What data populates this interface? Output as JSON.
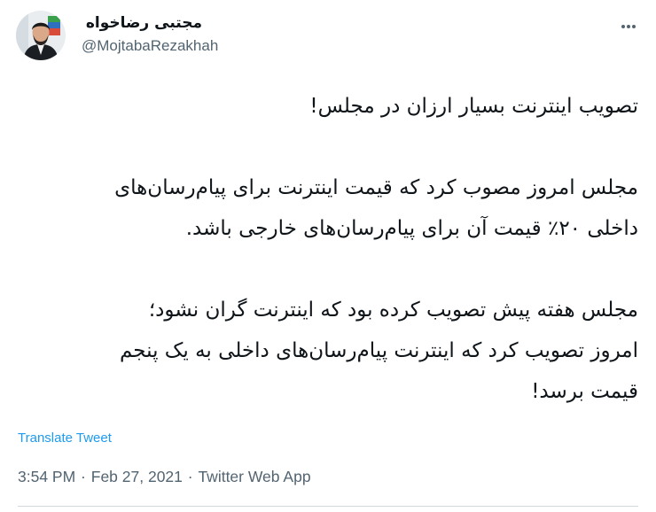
{
  "tweet": {
    "author": {
      "display_name": "مجتبی رضاخواه",
      "handle": "@MojtabaRezakhah"
    },
    "menu_icon": "more-horizontal-icon",
    "lines": [
      "تصویب اینترنت بسیار ارزان در مجلس!",
      "",
      "مجلس امروز مصوب کرد که قیمت اینترنت برای پیام‌رسان‌های",
      "داخلی ۲۰٪ قیمت آن برای پیام‌رسان‌های خارجی باشد.",
      "",
      "مجلس هفته پیش تصویب کرده بود که اینترنت گران نشود؛",
      "امروز تصویب کرد که اینترنت پیام‌رسان‌های داخلی به یک پنجم",
      "قیمت برسد!"
    ],
    "translate_label": "Translate Tweet",
    "time": "3:54 PM",
    "separator": " · ",
    "date": "Feb 27, 2021",
    "source": "Twitter Web App",
    "colors": {
      "text": "#0f1419",
      "secondary": "#536471",
      "link": "#1d9bf0"
    }
  }
}
